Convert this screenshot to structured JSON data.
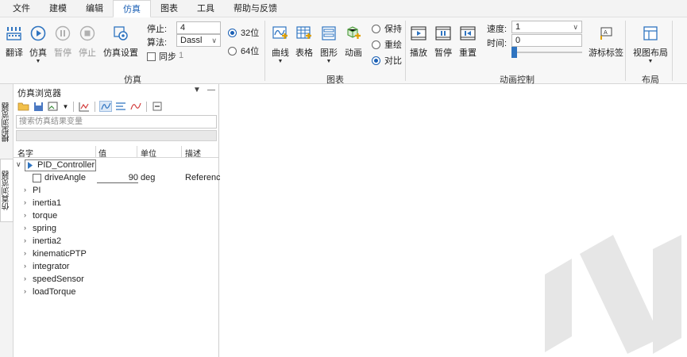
{
  "menu": [
    "文件",
    "建模",
    "编辑",
    "仿真",
    "图表",
    "工具",
    "帮助与反馈"
  ],
  "ribbon": {
    "sim_group": {
      "label": "仿真",
      "buttons": {
        "translate": "翻译",
        "simulate": "仿真",
        "pause": "暂停",
        "stop": "停止",
        "settings": "仿真设置"
      },
      "stop_label": "停止:",
      "stop_value": "4",
      "algo_label": "算法:",
      "algo_value": "Dassl",
      "sync_label": "同步",
      "sync_value": "1",
      "bits_32": "32位",
      "bits_64": "64位"
    },
    "chart_group": {
      "label": "图表",
      "buttons": {
        "curve": "曲线",
        "table": "表格",
        "shape": "图形",
        "animation": "动画"
      },
      "hold": "保持",
      "redraw": "重绘",
      "compare": "对比"
    },
    "anim_group": {
      "label": "动画控制",
      "buttons": {
        "play": "播放",
        "pause": "暂停",
        "reset": "重置"
      },
      "speed_label": "速度:",
      "speed_value": "1",
      "time_label": "时间:",
      "time_value": "0",
      "cursor_label": "游标标签"
    },
    "layout_group": {
      "label": "布局",
      "buttons": {
        "view_layout": "视图布局"
      }
    }
  },
  "side_tabs": {
    "model_browser": "模型浏览器",
    "sim_browser": "仿真浏览器"
  },
  "browser": {
    "title": "仿真浏览器",
    "search_placeholder": "搜索仿真结果变量",
    "columns": {
      "name": "名字",
      "value": "值",
      "unit": "单位",
      "desc": "描述"
    },
    "root": "PID_Controller",
    "child": {
      "name": "driveAngle",
      "value": "90",
      "unit": "deg",
      "desc": "Referenc"
    },
    "items": [
      "PI",
      "inertia1",
      "torque",
      "spring",
      "inertia2",
      "kinematicPTP",
      "integrator",
      "speedSensor",
      "loadTorque"
    ]
  },
  "colors": {
    "accent": "#1a5fb4",
    "play_blue": "#2f74c0",
    "watermark": "#e6e6e6"
  }
}
